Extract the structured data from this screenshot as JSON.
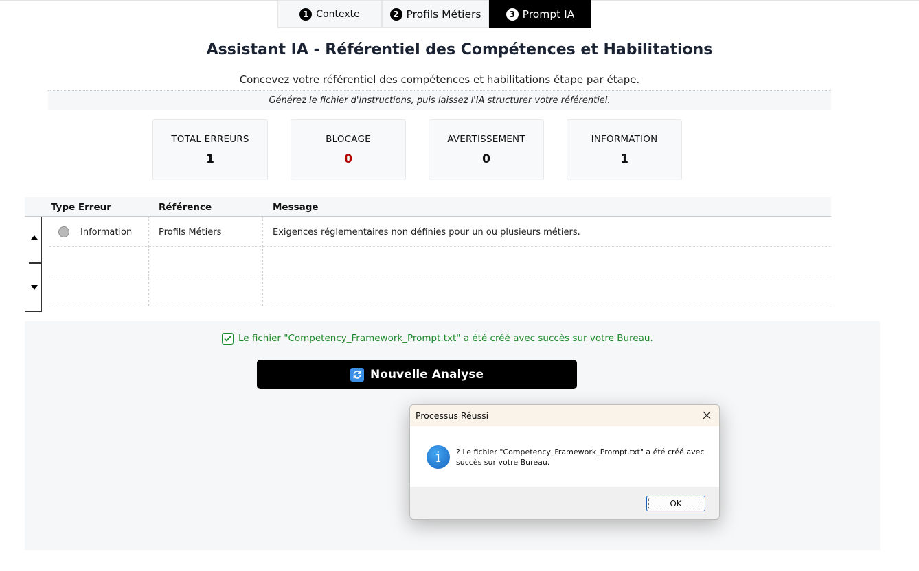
{
  "tabs": [
    {
      "num": "1",
      "label": "Contexte"
    },
    {
      "num": "2",
      "label": "Profils Métiers"
    },
    {
      "num": "3",
      "label": "Prompt IA"
    }
  ],
  "header": {
    "title": "Assistant IA - Référentiel des Compétences et Habilitations",
    "subtitle": "Concevez votre référentiel des compétences et habilitations étape par étape.",
    "hint": "Générez le fichier d'instructions, puis laissez l'IA structurer votre référentiel."
  },
  "stats": [
    {
      "label": "TOTAL ERREURS",
      "value": "1"
    },
    {
      "label": "BLOCAGE",
      "value": "0",
      "color": "#b00000"
    },
    {
      "label": "AVERTISSEMENT",
      "value": "0"
    },
    {
      "label": "INFORMATION",
      "value": "1"
    }
  ],
  "table": {
    "columns": [
      "Type Erreur",
      "Référence",
      "Message"
    ],
    "rows": [
      {
        "type": "Information",
        "reference": "Profils Métiers",
        "message": "Exigences réglementaires non définies pour un ou plusieurs métiers."
      }
    ]
  },
  "status": {
    "success_message": "Le fichier \"Competency_Framework_Prompt.txt\" a été créé avec succès sur votre Bureau.",
    "success_color": "#1d8a2a"
  },
  "actions": {
    "new_analysis_label": "Nouvelle Analyse"
  },
  "dialog": {
    "title": "Processus Réussi",
    "message": "? Le fichier \"Competency_Framework_Prompt.txt\" a été créé avec succès sur votre Bureau.",
    "ok_label": "OK"
  }
}
